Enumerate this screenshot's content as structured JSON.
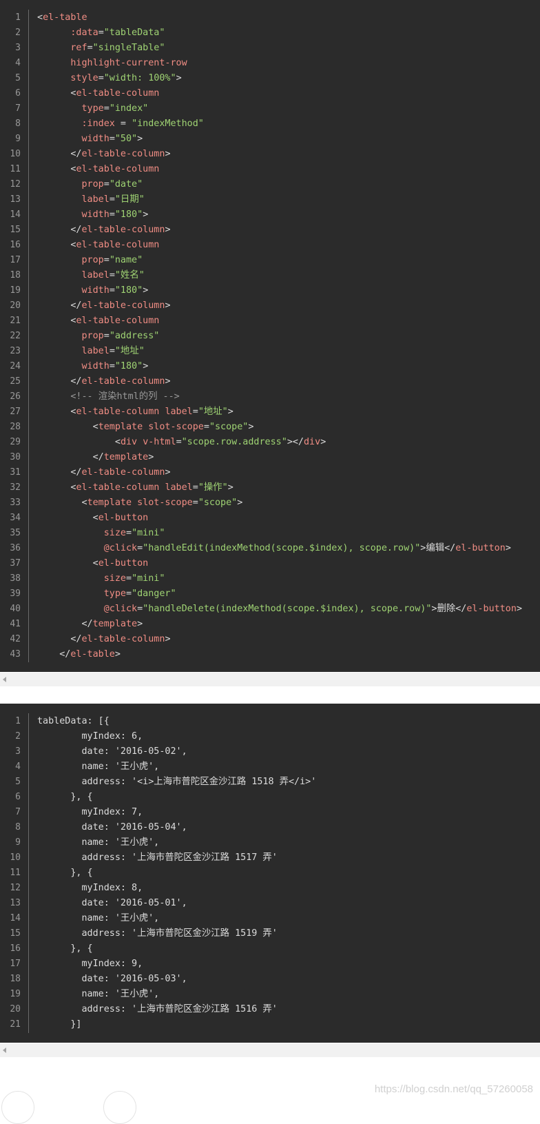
{
  "block1": {
    "lines": [
      {
        "n": "1",
        "parts": [
          [
            "p",
            "<"
          ],
          [
            "tag",
            "el-table"
          ]
        ]
      },
      {
        "n": "2",
        "parts": [
          [
            "p",
            "      "
          ],
          [
            "attr",
            ":data"
          ],
          [
            "p",
            "="
          ],
          [
            "str",
            "\"tableData\""
          ]
        ]
      },
      {
        "n": "3",
        "parts": [
          [
            "p",
            "      "
          ],
          [
            "attr",
            "ref"
          ],
          [
            "p",
            "="
          ],
          [
            "str",
            "\"singleTable\""
          ]
        ]
      },
      {
        "n": "4",
        "parts": [
          [
            "p",
            "      "
          ],
          [
            "attr",
            "highlight-current-row"
          ]
        ]
      },
      {
        "n": "5",
        "parts": [
          [
            "p",
            "      "
          ],
          [
            "attr",
            "style"
          ],
          [
            "p",
            "="
          ],
          [
            "str",
            "\"width: 100%\""
          ],
          [
            "p",
            ">"
          ]
        ]
      },
      {
        "n": "6",
        "parts": [
          [
            "p",
            "      <"
          ],
          [
            "tag",
            "el-table-column"
          ]
        ]
      },
      {
        "n": "7",
        "parts": [
          [
            "p",
            "        "
          ],
          [
            "attr",
            "type"
          ],
          [
            "p",
            "="
          ],
          [
            "str",
            "\"index\""
          ]
        ]
      },
      {
        "n": "8",
        "parts": [
          [
            "p",
            "        "
          ],
          [
            "attr",
            ":index"
          ],
          [
            "p",
            " = "
          ],
          [
            "str",
            "\"indexMethod\""
          ]
        ]
      },
      {
        "n": "9",
        "parts": [
          [
            "p",
            "        "
          ],
          [
            "attr",
            "width"
          ],
          [
            "p",
            "="
          ],
          [
            "str",
            "\"50\""
          ],
          [
            "p",
            ">"
          ]
        ]
      },
      {
        "n": "10",
        "parts": [
          [
            "p",
            "      </"
          ],
          [
            "tag",
            "el-table-column"
          ],
          [
            "p",
            ">"
          ]
        ]
      },
      {
        "n": "11",
        "parts": [
          [
            "p",
            "      <"
          ],
          [
            "tag",
            "el-table-column"
          ]
        ]
      },
      {
        "n": "12",
        "parts": [
          [
            "p",
            "        "
          ],
          [
            "attr",
            "prop"
          ],
          [
            "p",
            "="
          ],
          [
            "str",
            "\"date\""
          ]
        ]
      },
      {
        "n": "13",
        "parts": [
          [
            "p",
            "        "
          ],
          [
            "attr",
            "label"
          ],
          [
            "p",
            "="
          ],
          [
            "str",
            "\"日期\""
          ]
        ]
      },
      {
        "n": "14",
        "parts": [
          [
            "p",
            "        "
          ],
          [
            "attr",
            "width"
          ],
          [
            "p",
            "="
          ],
          [
            "str",
            "\"180\""
          ],
          [
            "p",
            ">"
          ]
        ]
      },
      {
        "n": "15",
        "parts": [
          [
            "p",
            "      </"
          ],
          [
            "tag",
            "el-table-column"
          ],
          [
            "p",
            ">"
          ]
        ]
      },
      {
        "n": "16",
        "parts": [
          [
            "p",
            "      <"
          ],
          [
            "tag",
            "el-table-column"
          ]
        ]
      },
      {
        "n": "17",
        "parts": [
          [
            "p",
            "        "
          ],
          [
            "attr",
            "prop"
          ],
          [
            "p",
            "="
          ],
          [
            "str",
            "\"name\""
          ]
        ]
      },
      {
        "n": "18",
        "parts": [
          [
            "p",
            "        "
          ],
          [
            "attr",
            "label"
          ],
          [
            "p",
            "="
          ],
          [
            "str",
            "\"姓名\""
          ]
        ]
      },
      {
        "n": "19",
        "parts": [
          [
            "p",
            "        "
          ],
          [
            "attr",
            "width"
          ],
          [
            "p",
            "="
          ],
          [
            "str",
            "\"180\""
          ],
          [
            "p",
            ">"
          ]
        ]
      },
      {
        "n": "20",
        "parts": [
          [
            "p",
            "      </"
          ],
          [
            "tag",
            "el-table-column"
          ],
          [
            "p",
            ">"
          ]
        ]
      },
      {
        "n": "21",
        "parts": [
          [
            "p",
            "      <"
          ],
          [
            "tag",
            "el-table-column"
          ]
        ]
      },
      {
        "n": "22",
        "parts": [
          [
            "p",
            "        "
          ],
          [
            "attr",
            "prop"
          ],
          [
            "p",
            "="
          ],
          [
            "str",
            "\"address\""
          ]
        ]
      },
      {
        "n": "23",
        "parts": [
          [
            "p",
            "        "
          ],
          [
            "attr",
            "label"
          ],
          [
            "p",
            "="
          ],
          [
            "str",
            "\"地址\""
          ]
        ]
      },
      {
        "n": "24",
        "parts": [
          [
            "p",
            "        "
          ],
          [
            "attr",
            "width"
          ],
          [
            "p",
            "="
          ],
          [
            "str",
            "\"180\""
          ],
          [
            "p",
            ">"
          ]
        ]
      },
      {
        "n": "25",
        "parts": [
          [
            "p",
            "      </"
          ],
          [
            "tag",
            "el-table-column"
          ],
          [
            "p",
            ">"
          ]
        ]
      },
      {
        "n": "26",
        "parts": [
          [
            "p",
            "      "
          ],
          [
            "cm",
            "<!-- 渲染html的列 -->"
          ]
        ]
      },
      {
        "n": "27",
        "parts": [
          [
            "p",
            "      <"
          ],
          [
            "tag",
            "el-table-column"
          ],
          [
            "p",
            " "
          ],
          [
            "attr",
            "label"
          ],
          [
            "p",
            "="
          ],
          [
            "str",
            "\"地址\""
          ],
          [
            "p",
            ">"
          ]
        ]
      },
      {
        "n": "28",
        "parts": [
          [
            "p",
            "          <"
          ],
          [
            "tag",
            "template"
          ],
          [
            "p",
            " "
          ],
          [
            "attr",
            "slot-scope"
          ],
          [
            "p",
            "="
          ],
          [
            "str",
            "\"scope\""
          ],
          [
            "p",
            ">"
          ]
        ]
      },
      {
        "n": "29",
        "parts": [
          [
            "p",
            "              <"
          ],
          [
            "tag",
            "div"
          ],
          [
            "p",
            " "
          ],
          [
            "attr",
            "v-html"
          ],
          [
            "p",
            "="
          ],
          [
            "str",
            "\"scope.row.address\""
          ],
          [
            "p",
            "></"
          ],
          [
            "tag",
            "div"
          ],
          [
            "p",
            ">"
          ]
        ]
      },
      {
        "n": "30",
        "parts": [
          [
            "p",
            "          </"
          ],
          [
            "tag",
            "template"
          ],
          [
            "p",
            ">"
          ]
        ]
      },
      {
        "n": "31",
        "parts": [
          [
            "p",
            "      </"
          ],
          [
            "tag",
            "el-table-column"
          ],
          [
            "p",
            ">"
          ]
        ]
      },
      {
        "n": "32",
        "parts": [
          [
            "p",
            "      <"
          ],
          [
            "tag",
            "el-table-column"
          ],
          [
            "p",
            " "
          ],
          [
            "attr",
            "label"
          ],
          [
            "p",
            "="
          ],
          [
            "str",
            "\"操作\""
          ],
          [
            "p",
            ">"
          ]
        ]
      },
      {
        "n": "33",
        "parts": [
          [
            "p",
            "        <"
          ],
          [
            "tag",
            "template"
          ],
          [
            "p",
            " "
          ],
          [
            "attr",
            "slot-scope"
          ],
          [
            "p",
            "="
          ],
          [
            "str",
            "\"scope\""
          ],
          [
            "p",
            ">"
          ]
        ]
      },
      {
        "n": "34",
        "parts": [
          [
            "p",
            "          <"
          ],
          [
            "tag",
            "el-button"
          ]
        ]
      },
      {
        "n": "35",
        "parts": [
          [
            "p",
            "            "
          ],
          [
            "attr",
            "size"
          ],
          [
            "p",
            "="
          ],
          [
            "str",
            "\"mini\""
          ]
        ]
      },
      {
        "n": "36",
        "parts": [
          [
            "p",
            "            "
          ],
          [
            "attr",
            "@click"
          ],
          [
            "p",
            "="
          ],
          [
            "str",
            "\"handleEdit(indexMethod(scope.$index), scope.row)\""
          ],
          [
            "p",
            ">编辑</"
          ],
          [
            "tag",
            "el-button"
          ],
          [
            "p",
            ">"
          ]
        ]
      },
      {
        "n": "37",
        "parts": [
          [
            "p",
            "          <"
          ],
          [
            "tag",
            "el-button"
          ]
        ]
      },
      {
        "n": "38",
        "parts": [
          [
            "p",
            "            "
          ],
          [
            "attr",
            "size"
          ],
          [
            "p",
            "="
          ],
          [
            "str",
            "\"mini\""
          ]
        ]
      },
      {
        "n": "39",
        "parts": [
          [
            "p",
            "            "
          ],
          [
            "attr",
            "type"
          ],
          [
            "p",
            "="
          ],
          [
            "str",
            "\"danger\""
          ]
        ]
      },
      {
        "n": "40",
        "parts": [
          [
            "p",
            "            "
          ],
          [
            "attr",
            "@click"
          ],
          [
            "p",
            "="
          ],
          [
            "str",
            "\"handleDelete(indexMethod(scope.$index), scope.row)\""
          ],
          [
            "p",
            ">删除</"
          ],
          [
            "tag",
            "el-button"
          ],
          [
            "p",
            ">"
          ]
        ]
      },
      {
        "n": "41",
        "parts": [
          [
            "p",
            "        </"
          ],
          [
            "tag",
            "template"
          ],
          [
            "p",
            ">"
          ]
        ]
      },
      {
        "n": "42",
        "parts": [
          [
            "p",
            "      </"
          ],
          [
            "tag",
            "el-table-column"
          ],
          [
            "p",
            ">"
          ]
        ]
      },
      {
        "n": "43",
        "parts": [
          [
            "p",
            "    </"
          ],
          [
            "tag",
            "el-table"
          ],
          [
            "p",
            ">"
          ]
        ]
      }
    ]
  },
  "block2": {
    "lines": [
      {
        "n": "1",
        "parts": [
          [
            "p",
            "tableData: [{"
          ]
        ]
      },
      {
        "n": "2",
        "parts": [
          [
            "p",
            "        myIndex: 6,"
          ]
        ]
      },
      {
        "n": "3",
        "parts": [
          [
            "p",
            "        date: '2016-05-02',"
          ]
        ]
      },
      {
        "n": "4",
        "parts": [
          [
            "p",
            "        name: '王小虎',"
          ]
        ]
      },
      {
        "n": "5",
        "parts": [
          [
            "p",
            "        address: '<i>上海市普陀区金沙江路 1518 弄</i>'"
          ]
        ]
      },
      {
        "n": "6",
        "parts": [
          [
            "p",
            "      }, {"
          ]
        ]
      },
      {
        "n": "7",
        "parts": [
          [
            "p",
            "        myIndex: 7,"
          ]
        ]
      },
      {
        "n": "8",
        "parts": [
          [
            "p",
            "        date: '2016-05-04',"
          ]
        ]
      },
      {
        "n": "9",
        "parts": [
          [
            "p",
            "        name: '王小虎',"
          ]
        ]
      },
      {
        "n": "10",
        "parts": [
          [
            "p",
            "        address: '上海市普陀区金沙江路 1517 弄'"
          ]
        ]
      },
      {
        "n": "11",
        "parts": [
          [
            "p",
            "      }, {"
          ]
        ]
      },
      {
        "n": "12",
        "parts": [
          [
            "p",
            "        myIndex: 8,"
          ]
        ]
      },
      {
        "n": "13",
        "parts": [
          [
            "p",
            "        date: '2016-05-01',"
          ]
        ]
      },
      {
        "n": "14",
        "parts": [
          [
            "p",
            "        name: '王小虎',"
          ]
        ]
      },
      {
        "n": "15",
        "parts": [
          [
            "p",
            "        address: '上海市普陀区金沙江路 1519 弄'"
          ]
        ]
      },
      {
        "n": "16",
        "parts": [
          [
            "p",
            "      }, {"
          ]
        ]
      },
      {
        "n": "17",
        "parts": [
          [
            "p",
            "        myIndex: 9,"
          ]
        ]
      },
      {
        "n": "18",
        "parts": [
          [
            "p",
            "        date: '2016-05-03',"
          ]
        ]
      },
      {
        "n": "19",
        "parts": [
          [
            "p",
            "        name: '王小虎',"
          ]
        ]
      },
      {
        "n": "20",
        "parts": [
          [
            "p",
            "        address: '上海市普陀区金沙江路 1516 弄'"
          ]
        ]
      },
      {
        "n": "21",
        "parts": [
          [
            "p",
            "      }]"
          ]
        ]
      }
    ]
  },
  "watermark": "https://blog.csdn.net/qq_57260058",
  "colors": {
    "code_bg": "#2b2b2b",
    "tag": "#f08d84",
    "string": "#9fd373",
    "comment": "#999999",
    "plain": "#dcdcdc"
  }
}
